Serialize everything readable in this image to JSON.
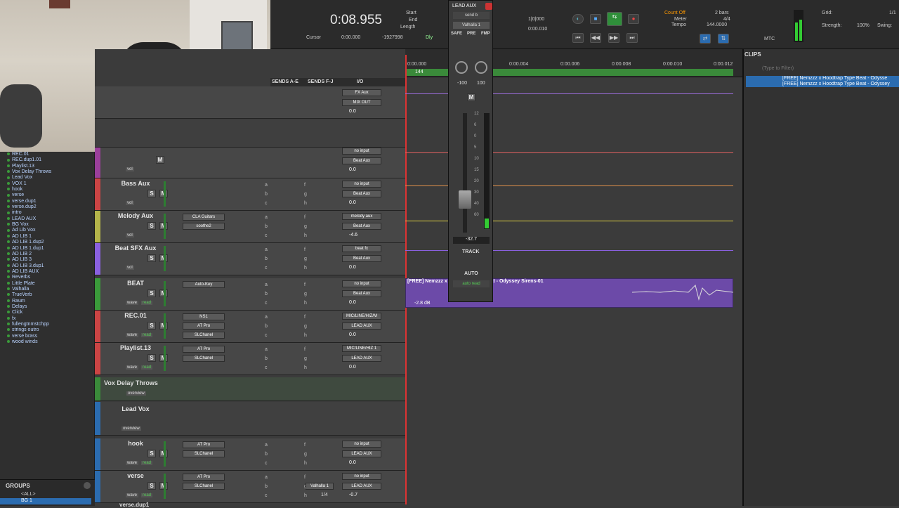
{
  "transport": {
    "counter": "0:08.955",
    "start_label": "Start",
    "end_label": "End",
    "length_label": "Length",
    "cursor_label": "Cursor",
    "cursor_value": "0:00.000",
    "cursor_right": "-1927998",
    "dly_label": "Dly",
    "mbt1": "1|0|000",
    "mbt2": "0:00.010",
    "count_off": "Count Off",
    "meter": "Meter",
    "tempo": "Tempo",
    "bars": "2 bars",
    "meter_val": "4/4",
    "tempo_val": "144.0000",
    "grid_label": "Grid:",
    "strength_label": "Strength:",
    "strength_val": "100%",
    "swing_label": "Swing:",
    "swing_val": "1/1",
    "mtc": "MTC"
  },
  "aux": {
    "name": "LEAD AUX",
    "send": "send b",
    "plugin": "Valhalla 1",
    "safe": "SAFE",
    "pre": "PRE",
    "fmp": "FMP",
    "pan_l": "-100",
    "pan_r": "100",
    "mute": "M",
    "level": "-32.7",
    "track": "TRACK",
    "auto": "AUTO",
    "auto_mode": "auto read",
    "scale": [
      "12",
      "6",
      "0",
      "5",
      "10",
      "15",
      "20",
      "30",
      "40",
      "60"
    ]
  },
  "ruler": {
    "marks": [
      "0:00.000",
      "0:00.004",
      "0:00.006",
      "0:00.008",
      "0:00.010",
      "0:00.012"
    ],
    "tempo_marker": "144"
  },
  "headers": {
    "sends_ae": "SENDS A-E",
    "sends_fj": "SENDS F-J",
    "io": "I/O"
  },
  "sidebar": {
    "tracks": [
      "REC.01",
      "REC.dup1.01",
      "Playlist.13",
      "Vox Delay Throws",
      "Lead Vox",
      "VOX 1",
      "hook",
      "verse",
      "verse.dup1",
      "verse.dup2",
      "intro",
      "LEAD AUX",
      "BG Vox",
      "Ad Lib Vox",
      "AD LIB 1",
      "AD LIB 1.dup2",
      "AD LIB 1.dup1",
      "AD LIB 2",
      "AD LIB 3",
      "AD LIB 3.dup1",
      "AD LIB AUX",
      "Reverbs",
      "Little Plate",
      "Valhalla",
      "TrueVerb",
      "Raum",
      "Delays",
      "Click",
      "fx",
      "fullengtnmstchpp",
      "strings outro",
      "verse brass",
      "wood winds"
    ],
    "groups_title": "GROUPS",
    "groups": [
      "<ALL>",
      "BG 1"
    ]
  },
  "tracks": [
    {
      "name": "Bass Aux",
      "ins": [
        "",
        ""
      ],
      "io": [
        "no input",
        "Beat Aux",
        "0.0"
      ],
      "mode": "vol"
    },
    {
      "name": "Melody Aux",
      "ins": [
        "CLA Guitars",
        "soothe2"
      ],
      "io": [
        "melody aux",
        "Beat Aux",
        "-4.6"
      ],
      "mode": "vol"
    },
    {
      "name": "Beat SFX Aux",
      "ins": [
        "",
        ""
      ],
      "io": [
        "beat fx",
        "Beat Aux",
        "0.0"
      ],
      "mode": "vol"
    },
    {
      "name": "BEAT",
      "ins": [
        "Auto-Key",
        ""
      ],
      "io": [
        "no input",
        "Beat Aux",
        "0.0"
      ],
      "mode": "wave",
      "read": "read"
    },
    {
      "name": "REC.01",
      "ins": [
        "NS1",
        "AT Pro",
        "SLChanel"
      ],
      "io": [
        "MIC/LINE/HIZ/M",
        "LEAD AUX",
        "0.0"
      ],
      "mode": "wave",
      "read": "read"
    },
    {
      "name": "Playlist.13",
      "ins": [
        "AT Pro",
        "SLChanel"
      ],
      "io": [
        "MIC/LINE/HIZ 1",
        "LEAD AUX",
        "0.0"
      ],
      "mode": "wave",
      "read": "read"
    },
    {
      "name": "hook",
      "ins": [
        "AT Pro",
        "SLChanel"
      ],
      "io": [
        "no input",
        "LEAD AUX",
        "0.0"
      ],
      "mode": "wave",
      "read": "read"
    },
    {
      "name": "verse",
      "ins": [
        "AT Pro",
        "SLChanel"
      ],
      "io": [
        "no input",
        "LEAD AUX",
        "-0.7"
      ],
      "mode": "wave",
      "read": "read",
      "send": "Valhalla 1",
      "send_val": "1/4"
    }
  ],
  "top_track": {
    "io": [
      "FX Aux",
      "MIX OUT",
      "0.0"
    ]
  },
  "unnamed_track": {
    "io": [
      "no input",
      "Beat Aux",
      "0.0"
    ],
    "mode": "vol"
  },
  "folders": {
    "vox_delay": "Vox Delay Throws",
    "vox_delay_view": "overview",
    "lead_vox": "Lead Vox",
    "lead_vox_view": "overview",
    "next": "verse.dup1"
  },
  "region": {
    "name": "[FREE] Nemzzz x Hoodtrap Type Beat - Odyssey Sirens-01",
    "gain": "-2.8 dB"
  },
  "clips": {
    "title": "CLIPS",
    "filter": "(Type to Filter)",
    "items": [
      "[FREE] Nemzzz x Hoodtrap Type Beat - Odysse",
      "[FREE] Nemzzz x Hoodtrap Type Beat - Odyssey"
    ]
  }
}
